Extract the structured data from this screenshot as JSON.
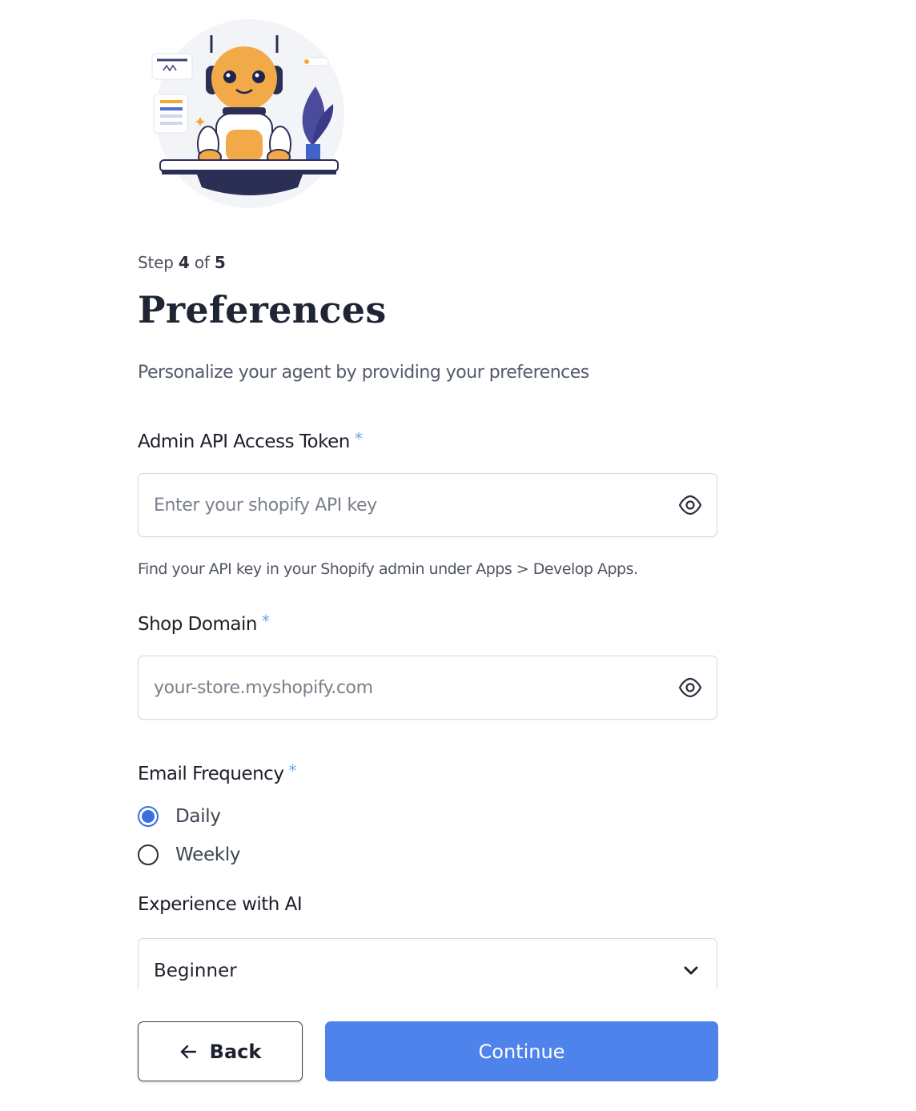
{
  "illustration": {
    "icon": "robot-assistant-illustration"
  },
  "step": {
    "prefix": "Step",
    "current": "4",
    "middle": "of",
    "total": "5"
  },
  "title": "Preferences",
  "subtitle": "Personalize your agent by providing your preferences",
  "fields": {
    "api_token": {
      "label": "Admin API Access Token",
      "required_mark": "*",
      "placeholder": "Enter your shopify API key",
      "value": "",
      "icon": "eye-icon",
      "help": "Find your API key in your Shopify admin under Apps > Develop Apps."
    },
    "shop_domain": {
      "label": "Shop Domain",
      "required_mark": "*",
      "placeholder": "your-store.myshopify.com",
      "value": "",
      "icon": "eye-icon"
    }
  },
  "email_frequency": {
    "label": "Email Frequency",
    "required_mark": "*",
    "options": [
      {
        "label": "Daily",
        "checked": true
      },
      {
        "label": "Weekly",
        "checked": false
      }
    ]
  },
  "experience": {
    "label": "Experience with AI",
    "selected": "Beginner",
    "icon": "chevron-down-icon"
  },
  "buttons": {
    "back": {
      "label": "Back",
      "icon": "arrow-left-icon"
    },
    "continue": {
      "label": "Continue"
    }
  },
  "colors": {
    "accent": "#4f83ec",
    "radio_checked": "#3b6fe0",
    "required": "#6aa7e8",
    "title": "#1f2534"
  }
}
